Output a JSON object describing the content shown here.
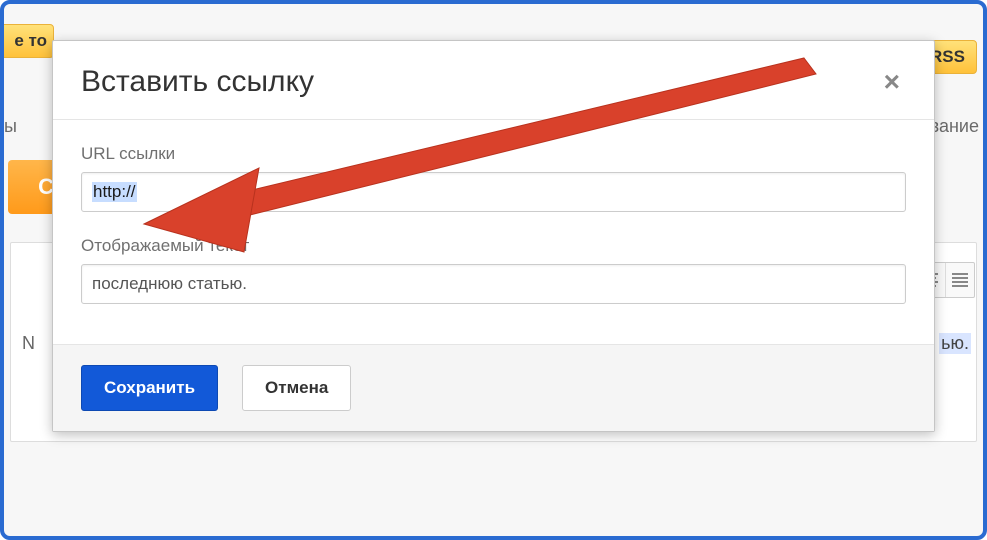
{
  "background": {
    "left_button_fragment": "е то",
    "right_button_fragment": "RSS",
    "text_fragment_left": "ы",
    "text_fragment_right": "ование",
    "orange_fragment": "С",
    "editor_left_fragment": "N",
    "editor_right_fragment": "ью."
  },
  "modal": {
    "title": "Вставить ссылку",
    "url_label": "URL ссылки",
    "url_value": "http://",
    "display_label": "Отображаемый текст",
    "display_value": "последнюю статью.",
    "save_label": "Сохранить",
    "cancel_label": "Отмена"
  },
  "annotation": {
    "arrow_color": "#d9412b"
  }
}
